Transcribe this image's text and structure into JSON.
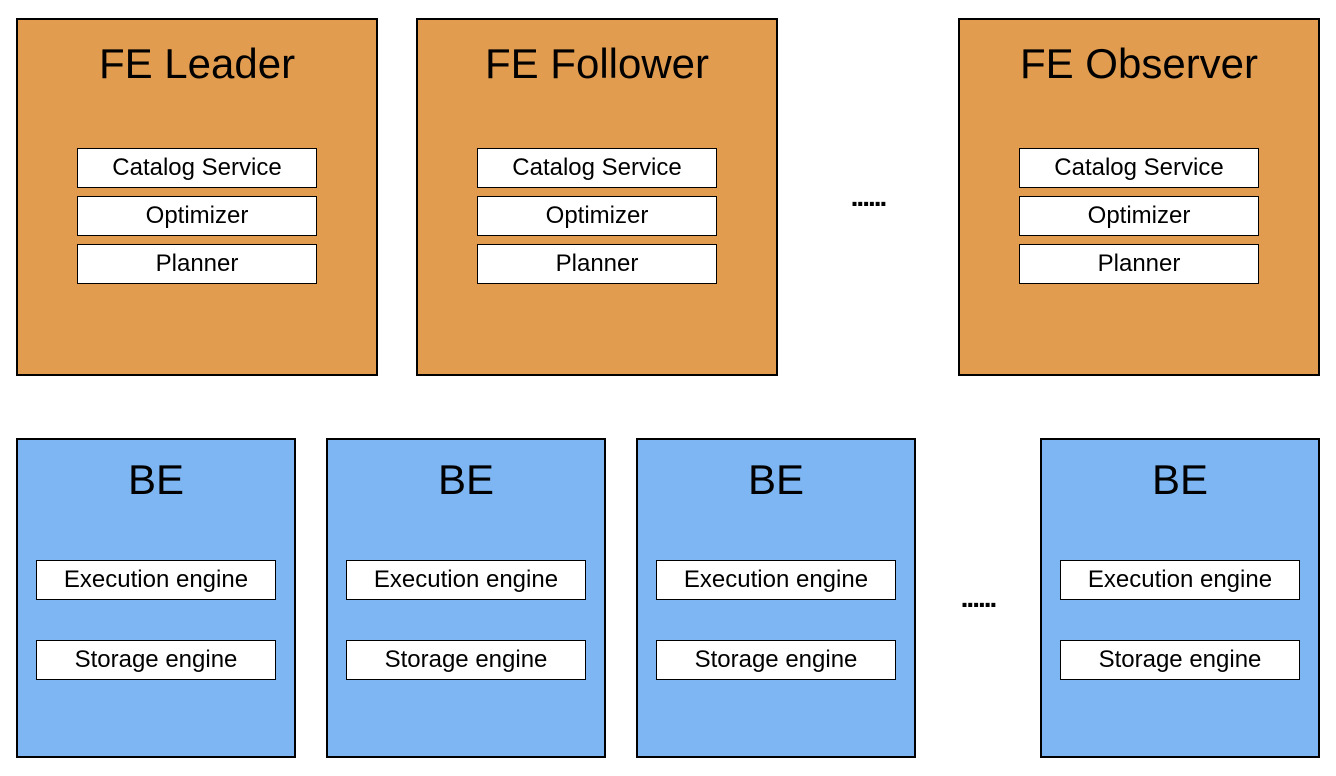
{
  "colors": {
    "fe_bg": "#e19c50",
    "be_bg": "#7db6f2",
    "inner_bg": "#ffffff",
    "border": "#000000"
  },
  "ellipsis": "......",
  "fe_nodes": [
    {
      "title": "FE Leader",
      "components": [
        "Catalog Service",
        "Optimizer",
        "Planner"
      ]
    },
    {
      "title": "FE Follower",
      "components": [
        "Catalog Service",
        "Optimizer",
        "Planner"
      ]
    },
    {
      "title": "FE Observer",
      "components": [
        "Catalog Service",
        "Optimizer",
        "Planner"
      ]
    }
  ],
  "be_nodes": [
    {
      "title": "BE",
      "components": [
        "Execution engine",
        "Storage engine"
      ]
    },
    {
      "title": "BE",
      "components": [
        "Execution engine",
        "Storage engine"
      ]
    },
    {
      "title": "BE",
      "components": [
        "Execution engine",
        "Storage engine"
      ]
    },
    {
      "title": "BE",
      "components": [
        "Execution engine",
        "Storage engine"
      ]
    }
  ]
}
